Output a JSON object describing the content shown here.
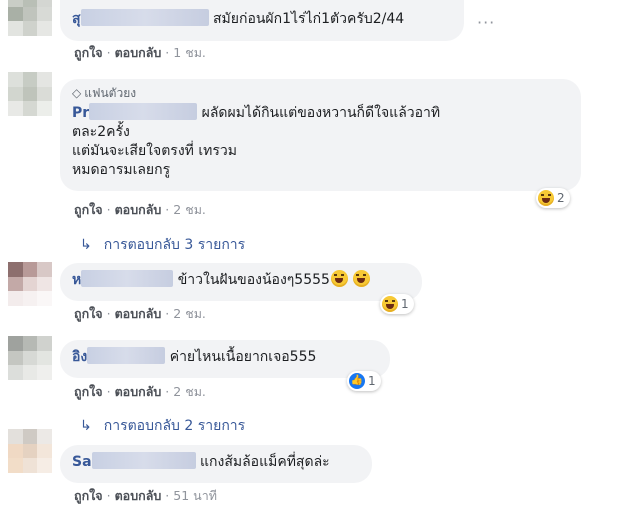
{
  "actions": {
    "like": "ถูกใจ",
    "reply": "ตอบกลับ",
    "dot": "·"
  },
  "fan_badge": {
    "icon": "diamond-icon",
    "label": "แฟนตัวยง"
  },
  "comments": [
    {
      "name_prefix": "สุ",
      "text": "สมัยก่อนผัก1ไร่ไก่1ตัวครับ2/44",
      "time": "1 ชม."
    },
    {
      "name_prefix": "Pr",
      "text_lines": [
        "ผลัดผมได้กินแต่ของหวานก็ดีใจแล้วอาทิ",
        "ตละ2ครั้ง",
        "แต่มันจะเสียใจตรงที่ เทรวม",
        "หมดอารมเลยกรู"
      ],
      "time": "2 ชม.",
      "reaction_count": "2",
      "reaction_icon": "laughing-emoji-icon"
    },
    {
      "name_prefix": "ห",
      "text": "ข้าวในฝันของน้องๆ5555",
      "time": "2 ชม.",
      "reaction_count": "1",
      "reaction_icon": "laughing-emoji-icon"
    },
    {
      "name_prefix": "อิง",
      "text": "ค่ายไหนเนื้อยากเจอ555",
      "time": "2 ชม.",
      "reaction_count": "1",
      "reaction_icon": "like-icon"
    },
    {
      "name_prefix": "Sa",
      "text": "แกงส้มล้อแม็คที่สุดล่ะ",
      "time": "51 นาที"
    }
  ],
  "replies": [
    {
      "label": "การตอบกลับ 3 รายการ"
    },
    {
      "label": "การตอบกลับ 2 รายการ"
    }
  ],
  "colors": {
    "link": "#385898",
    "bubble": "#f2f3f5",
    "meta": "#90949c"
  }
}
